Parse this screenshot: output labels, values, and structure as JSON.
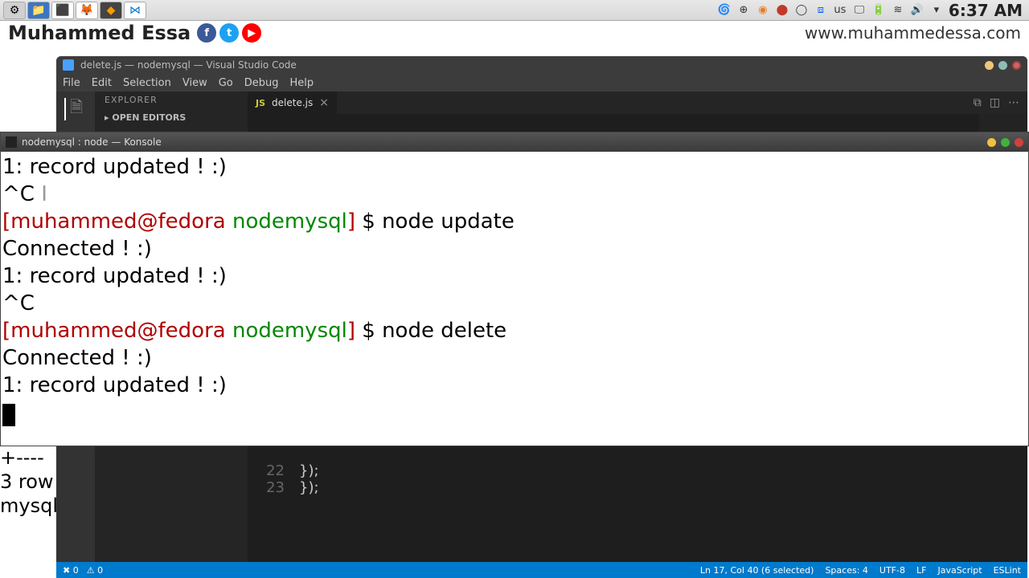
{
  "sys": {
    "tray_us": "us",
    "clock": "6:37 AM"
  },
  "banner": {
    "name": "Muhammed Essa",
    "fb": "f",
    "tw": "t",
    "yt": "▶",
    "url": "www.muhammedessa.com"
  },
  "vscode": {
    "title": "delete.js — nodemysql — Visual Studio Code",
    "menu": [
      "File",
      "Edit",
      "Selection",
      "View",
      "Go",
      "Debug",
      "Help"
    ],
    "side_header": "EXPLORER",
    "open_editors": "▸ OPEN EDITORS",
    "tab": {
      "icon": "JS",
      "name": "delete.js"
    },
    "code_lines": [
      {
        "n": "22",
        "t": "    });"
      },
      {
        "n": "23",
        "t": "});"
      }
    ],
    "status": {
      "errors": "✖ 0",
      "warnings": "⚠ 0",
      "pos": "Ln 17, Col 40 (6 selected)",
      "spaces": "Spaces: 4",
      "enc": "UTF-8",
      "eol": "LF",
      "lang": "JavaScript",
      "eslint": "ESLint"
    }
  },
  "konsole": {
    "title": "nodemysql : node — Konsole",
    "lines": [
      {
        "type": "plain",
        "t": "1: record updated ! :)"
      },
      {
        "type": "ctrl",
        "t": "^C"
      },
      {
        "type": "prompt",
        "user": "[muhammed@fedora ",
        "dir": "nodemysql",
        "bracket": "]",
        "sep": " $ ",
        "cmd": "node update"
      },
      {
        "type": "plain",
        "t": "Connected ! :)"
      },
      {
        "type": "plain",
        "t": "1: record updated ! :)"
      },
      {
        "type": "plain",
        "t": "^C"
      },
      {
        "type": "prompt",
        "user": "[muhammed@fedora ",
        "dir": "nodemysql",
        "bracket": "]",
        "sep": " $ ",
        "cmd": "node delete"
      },
      {
        "type": "plain",
        "t": "Connected ! :)"
      },
      {
        "type": "plain",
        "t": "1: record updated ! :)"
      }
    ]
  },
  "bg_term": {
    "l1": "+----",
    "l2": "3 row",
    "l3": "",
    "l4": "mysql"
  }
}
